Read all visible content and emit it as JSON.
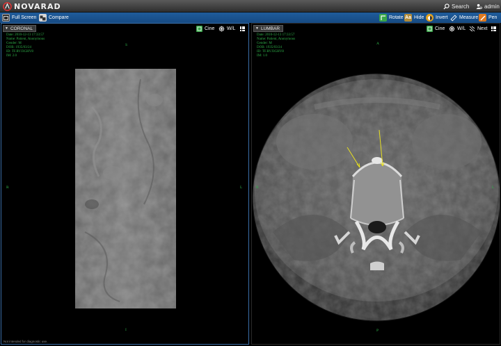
{
  "app": {
    "logo_text": "NOVARAD"
  },
  "topbar": {
    "search_label": "Search",
    "user_label": "admin"
  },
  "toolbar": {
    "fullscreen_label": "Full Screen",
    "compare_label": "Compare",
    "rotate_label": "Rotate",
    "hide_label": "Hide",
    "hide_icon_text": "Aa",
    "invert_label": "Invert",
    "measure_label": "Measure",
    "pen_label": "Pen"
  },
  "viewport_left": {
    "series_label": "CORONAL",
    "cine_label": "Cine",
    "wl_label": "W/L",
    "info": {
      "date": "Date: 2010-12-13 17:33:57",
      "name": "Name: Patient, Anonymous",
      "gender": "Gender: M",
      "dob": "DOB: 1935/03/24",
      "id": "ID: TF.RVJ3GHV8",
      "im": "IM: 2.0"
    },
    "orientation": {
      "top": "S",
      "bottom": "I",
      "left": "R",
      "right": "L"
    },
    "footer_note": "Not intended for diagnostic use."
  },
  "viewport_right": {
    "series_label": "LUMBAR",
    "cine_label": "Cine",
    "wl_label": "W/L",
    "next_label": "Next",
    "info": {
      "date": "Date: 2010-12-13 17:33:57",
      "name": "Name: Patient, Anonymous",
      "gender": "Gender: M",
      "dob": "DOB: 1935/03/24",
      "id": "ID: TF.RVJ3GHV8",
      "im": "IM: 1.0"
    },
    "orientation": {
      "top": "A",
      "bottom": "P",
      "left": "R",
      "right": "L"
    }
  },
  "colors": {
    "toolbar_blue": "#1a5590",
    "overlay_green": "#2fb44a",
    "annotation_yellow": "#e8e020",
    "rotate_green": "#3aa64a",
    "hide_tan": "#b08a3a",
    "invert_orange": "#e0a020",
    "pen_orange": "#e07a20"
  },
  "icons": [
    "novarad-logo-icon",
    "search-icon",
    "user-icon",
    "fullscreen-icon",
    "compare-icon",
    "rotate-icon",
    "hide-icon",
    "invert-icon",
    "measure-icon",
    "pen-icon",
    "cine-icon",
    "wl-icon",
    "next-icon",
    "layout-grid-icon"
  ]
}
